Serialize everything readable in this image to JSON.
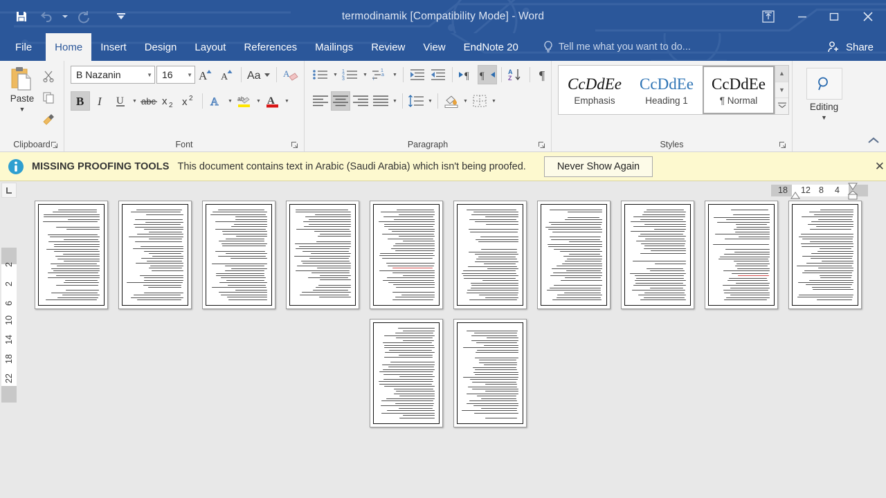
{
  "window": {
    "title": "termodinamik [Compatibility Mode] - Word",
    "accent_color": "#2b579a",
    "quick_access": [
      {
        "name": "save",
        "icon": "save-icon"
      },
      {
        "name": "undo",
        "icon": "undo-icon"
      },
      {
        "name": "redo",
        "icon": "redo-icon"
      },
      {
        "name": "customize",
        "icon": "chevron-down-icon"
      }
    ],
    "controls": [
      {
        "name": "ribbon-display-options",
        "icon": "ribbon-options-icon"
      },
      {
        "name": "minimize",
        "icon": "minimize-icon"
      },
      {
        "name": "restore",
        "icon": "restore-icon"
      },
      {
        "name": "close",
        "icon": "close-icon"
      }
    ]
  },
  "tabs": [
    {
      "label": "File",
      "active": false
    },
    {
      "label": "Home",
      "active": true
    },
    {
      "label": "Insert",
      "active": false
    },
    {
      "label": "Design",
      "active": false
    },
    {
      "label": "Layout",
      "active": false
    },
    {
      "label": "References",
      "active": false
    },
    {
      "label": "Mailings",
      "active": false
    },
    {
      "label": "Review",
      "active": false
    },
    {
      "label": "View",
      "active": false
    },
    {
      "label": "EndNote 20",
      "active": false
    }
  ],
  "tell_me": {
    "placeholder": "Tell me what you want to do..."
  },
  "share": {
    "label": "Share"
  },
  "ribbon": {
    "clipboard": {
      "group_label": "Clipboard",
      "paste_label": "Paste",
      "cut_name": "cut",
      "copy_name": "copy",
      "format_painter_name": "format-painter"
    },
    "font": {
      "group_label": "Font",
      "font_name": "B Nazanin",
      "font_size": "16",
      "buttons": [
        "grow-font",
        "shrink-font",
        "change-case",
        "clear-formatting",
        "bold",
        "italic",
        "underline",
        "strikethrough",
        "subscript",
        "superscript",
        "text-effects",
        "text-highlight-color",
        "font-color"
      ],
      "bold_active": true
    },
    "paragraph": {
      "group_label": "Paragraph",
      "buttons": [
        "bullets",
        "numbering",
        "multilevel-list",
        "decrease-indent",
        "increase-indent",
        "ltr-text-direction",
        "rtl-text-direction",
        "sort",
        "show-formatting-marks",
        "align-left",
        "center",
        "align-right",
        "justify",
        "line-spacing",
        "shading",
        "borders"
      ],
      "rtl_active": true,
      "center_active": true
    },
    "styles": {
      "group_label": "Styles",
      "items": [
        {
          "preview": "CcDdEe",
          "name": "Emphasis",
          "selected": false
        },
        {
          "preview": "CcDdEe",
          "name": "Heading 1",
          "selected": false
        },
        {
          "preview": "CcDdEe",
          "name": "¶ Normal",
          "selected": true
        }
      ]
    },
    "editing": {
      "group_label": "Editing",
      "label": "Editing",
      "icon": "search-icon"
    }
  },
  "message_bar": {
    "icon": "info-icon",
    "headline": "MISSING PROOFING TOOLS",
    "text": "This document contains text in Arabic (Saudi Arabia) which isn't being proofed.",
    "button_label": "Never Show Again",
    "close_label": "✕",
    "background": "#fdf9cf"
  },
  "rulers": {
    "corner_icon": "tab-stop-left-icon",
    "horizontal_ticks": [
      "18",
      "12",
      "8",
      "4"
    ],
    "vertical_ticks": [
      "2",
      "2",
      "6",
      "10",
      "14",
      "18",
      "22"
    ]
  },
  "document": {
    "view": "multiple-pages",
    "page_count": 12,
    "rows": [
      {
        "pages": [
          1,
          2,
          3,
          4,
          5,
          6,
          7,
          8,
          9,
          10
        ]
      },
      {
        "pages": [
          11,
          12
        ]
      }
    ]
  }
}
